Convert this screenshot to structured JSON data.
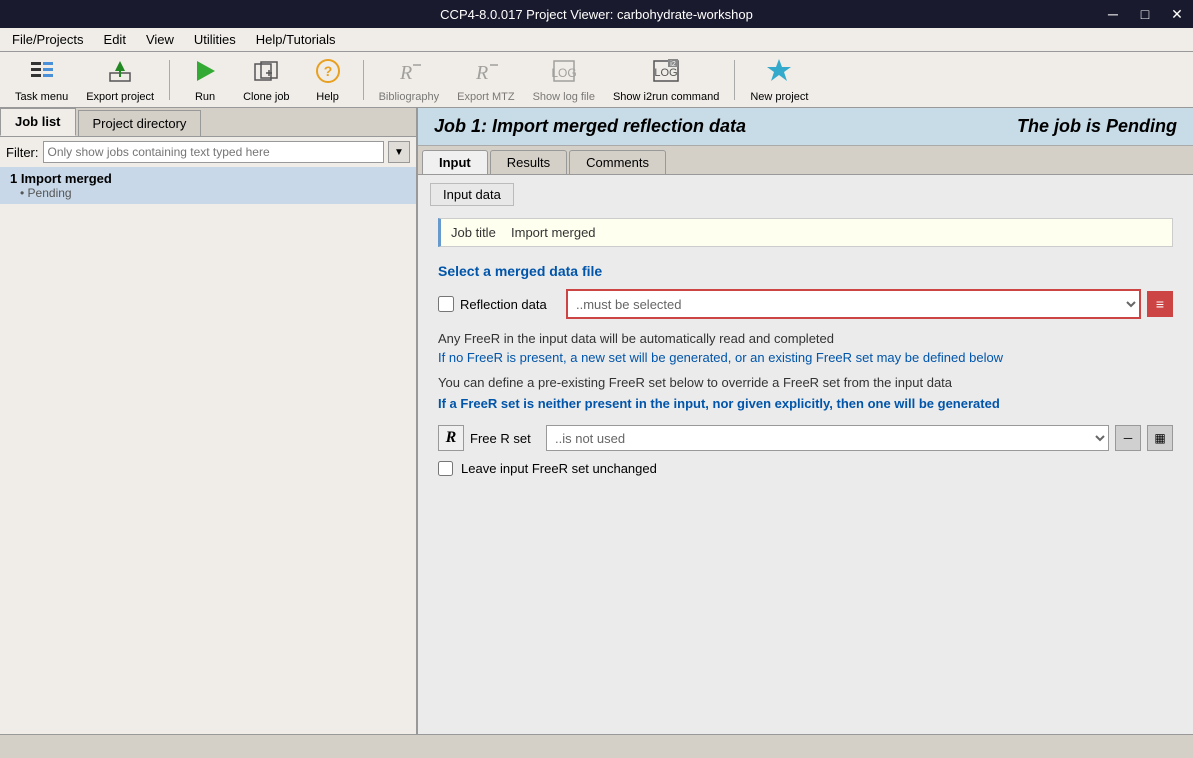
{
  "titleBar": {
    "title": "CCP4-8.0.017 Project Viewer: carbohydrate-workshop",
    "minimizeBtn": "─",
    "maximizeBtn": "□",
    "closeBtn": "✕"
  },
  "menuBar": {
    "items": [
      "File/Projects",
      "Edit",
      "View",
      "Utilities",
      "Help/Tutorials"
    ]
  },
  "toolbar": {
    "buttons": [
      {
        "id": "task-menu",
        "label": "Task menu",
        "icon": "≡"
      },
      {
        "id": "export-project",
        "label": "Export project",
        "icon": "⬆"
      },
      {
        "id": "run",
        "label": "Run",
        "icon": "▶"
      },
      {
        "id": "clone-job",
        "label": "Clone job",
        "icon": "⧉"
      },
      {
        "id": "help",
        "label": "Help",
        "icon": "?"
      },
      {
        "id": "bibliography",
        "label": "Bibliography",
        "icon": "R"
      },
      {
        "id": "export-mtz",
        "label": "Export MTZ",
        "icon": "R"
      },
      {
        "id": "show-log-file",
        "label": "Show log file",
        "icon": "▣"
      },
      {
        "id": "show-i2run",
        "label": "Show i2run command",
        "icon": "▣"
      },
      {
        "id": "new-project",
        "label": "New project",
        "icon": "✦"
      }
    ]
  },
  "leftPanel": {
    "tabs": [
      {
        "id": "job-list",
        "label": "Job list",
        "active": true
      },
      {
        "id": "project-directory",
        "label": "Project directory",
        "active": false
      }
    ],
    "filter": {
      "label": "Filter:",
      "placeholder": "Only show jobs containing text typed here"
    },
    "jobs": [
      {
        "id": 1,
        "title": "1 Import merged",
        "status": "Pending",
        "selected": true
      }
    ]
  },
  "rightPanel": {
    "jobTitle": "Job 1:  Import merged reflection data",
    "jobStatus": "The job is Pending",
    "tabs": [
      {
        "id": "input",
        "label": "Input",
        "active": true
      },
      {
        "id": "results",
        "label": "Results",
        "active": false
      },
      {
        "id": "comments",
        "label": "Comments",
        "active": false
      }
    ],
    "inputTab": {
      "sectionLabel": "Input data",
      "jobTitleLabel": "Job title",
      "jobTitleValue": "Import merged",
      "selectDataHeader": "Select a merged data file",
      "reflectionLabel": "Reflection data",
      "reflectionPlaceholder": "..must be selected",
      "infoText1": "Any FreeR in the input data will be automatically read and completed",
      "infoText2": "If no FreeR is present, a new set will be generated, or an existing FreeR set may be defined below",
      "infoText3": "You can define a pre-existing FreeR set below to override a FreeR set from the input data",
      "infoTextBlue": "If a FreeR set is neither present in the input, nor given explicitly, then one will be generated",
      "freerLabel": "Free R set",
      "freerPlaceholder": "..is not used",
      "leaveLabel": "Leave input FreeR set unchanged"
    }
  },
  "statusBar": {
    "text": ""
  }
}
